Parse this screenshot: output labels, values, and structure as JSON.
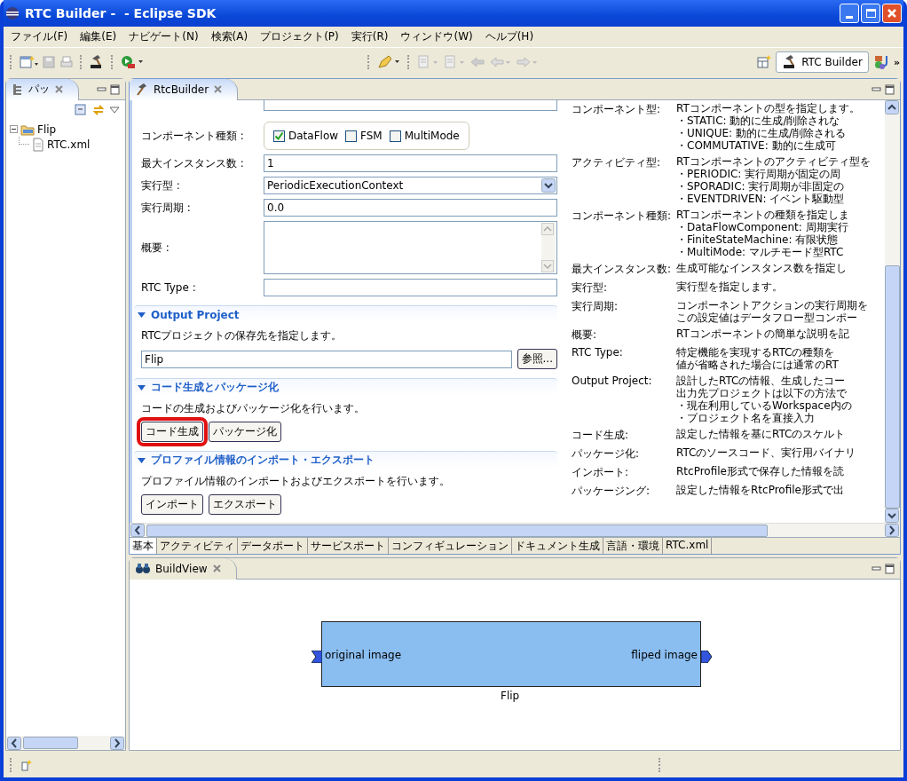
{
  "window": {
    "title": "RTC Builder -  - Eclipse SDK"
  },
  "menu": [
    "ファイル(F)",
    "編集(E)",
    "ナビゲート(N)",
    "検索(A)",
    "プロジェクト(P)",
    "実行(R)",
    "ウィンドウ(W)",
    "ヘルプ(H)"
  ],
  "perspective": {
    "label": "RTC Builder",
    "overflow": "»"
  },
  "left_view": {
    "tab": "パッ",
    "tree": [
      {
        "label": "Flip",
        "expanded": true,
        "children": [
          {
            "label": "RTC.xml"
          }
        ]
      }
    ]
  },
  "editor": {
    "tab": "RtcBuilder",
    "component_kind": {
      "label": "コンポーネント種類 :",
      "options": [
        {
          "label": "DataFlow",
          "checked": true
        },
        {
          "label": "FSM",
          "checked": false
        },
        {
          "label": "MultiMode",
          "checked": false
        }
      ]
    },
    "fields": [
      {
        "label": "最大インスタンス数 :",
        "kind": "text",
        "value": "1"
      },
      {
        "label": "実行型 :",
        "kind": "select",
        "value": "PeriodicExecutionContext"
      },
      {
        "label": "実行周期 :",
        "kind": "text",
        "value": "0.0"
      },
      {
        "label": "概要 :",
        "kind": "textarea"
      },
      {
        "label": "RTC Type :",
        "kind": "text"
      }
    ],
    "sections": [
      {
        "title": "Output Project",
        "description": "RTCプロジェクトの保存先を指定します。",
        "value": "Flip",
        "buttons": [
          {
            "label": "参照...",
            "highlighted": false
          }
        ]
      },
      {
        "title": "コード生成とパッケージ化",
        "description": "コードの生成およびパッケージ化を行います。",
        "buttons": [
          {
            "label": "コード生成",
            "highlighted": true
          },
          {
            "label": "パッケージ化",
            "highlighted": false
          }
        ]
      },
      {
        "title": "プロファイル情報のインポート・エクスポート",
        "description": "プロファイル情報のインポートおよびエクスポートを行います。",
        "buttons": [
          {
            "label": "インポート",
            "highlighted": false
          },
          {
            "label": "エクスポート",
            "highlighted": false
          }
        ]
      }
    ],
    "help": [
      {
        "term": "コンポーネント型:",
        "lines": [
          "RTコンポーネントの型を指定します。",
          "・STATIC: 動的に生成/削除されな",
          "・UNIQUE: 動的に生成/削除される",
          "・COMMUTATIVE: 動的に生成可"
        ]
      },
      {
        "term": "アクティビティ型:",
        "lines": [
          "RTコンポーネントのアクティビティ型を",
          "・PERIODIC: 実行周期が固定の周",
          "・SPORADIC: 実行周期が非固定の",
          "・EVENTDRIVEN: イベント駆動型"
        ]
      },
      {
        "term": "コンポーネント種類:",
        "lines": [
          "RTコンポーネントの種類を指定しま",
          "・DataFlowComponent: 周期実行",
          "・FiniteStateMachine: 有限状態",
          "・MultiMode: マルチモード型RTC"
        ]
      },
      {
        "term": "最大インスタンス数:",
        "lines": [
          "生成可能なインスタンス数を指定し"
        ]
      },
      {
        "term": "実行型:",
        "lines": [
          "実行型を指定します。"
        ]
      },
      {
        "term": "実行周期:",
        "lines": [
          "コンポーネントアクションの実行周期を",
          "この設定値はデータフロー型コンポー"
        ]
      },
      {
        "term": "概要:",
        "lines": [
          "RTコンポーネントの簡単な説明を記"
        ]
      },
      {
        "term": "RTC Type:",
        "lines": [
          "特定機能を実現するRTCの種類を",
          "値が省略された場合には通常のRT"
        ]
      },
      {
        "term": "Output Project:",
        "lines": [
          "設計したRTCの情報、生成したコー",
          "出力先プロジェクトは以下の方法で",
          "・現在利用しているWorkspace内の",
          "・プロジェクト名を直接入力"
        ]
      },
      {
        "term": "コード生成:",
        "lines": [
          "設定した情報を基にRTCのスケルト"
        ]
      },
      {
        "term": "パッケージ化:",
        "lines": [
          "RTCのソースコード、実行用バイナリ"
        ]
      },
      {
        "term": "インポート:",
        "lines": [
          "RtcProfile形式で保存した情報を読"
        ]
      },
      {
        "term": "パッケージング:",
        "lines": [
          "設定した情報をRtcProfile形式で出"
        ]
      }
    ],
    "bottom_tabs": [
      {
        "label": "基本",
        "selected": true
      },
      {
        "label": "アクティビティ",
        "selected": false
      },
      {
        "label": "データポート",
        "selected": false
      },
      {
        "label": "サービスポート",
        "selected": false
      },
      {
        "label": "コンフィギュレーション",
        "selected": false
      },
      {
        "label": "ドキュメント生成",
        "selected": false
      },
      {
        "label": "言語・環境",
        "selected": false
      },
      {
        "label": "RTC.xml",
        "selected": false
      }
    ]
  },
  "build_view": {
    "tab": "BuildView",
    "component": {
      "name": "Flip",
      "inports": [
        "original image"
      ],
      "outports": [
        "fliped image"
      ]
    }
  }
}
